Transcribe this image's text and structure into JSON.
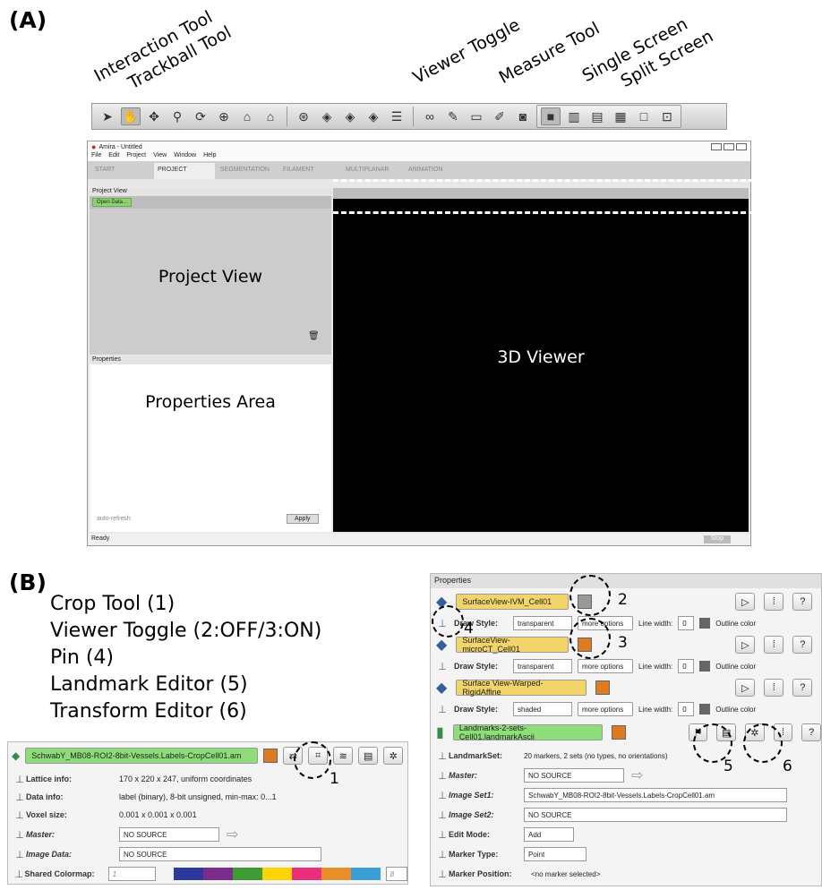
{
  "labels": {
    "a": "(A)",
    "b": "(B)"
  },
  "callouts": [
    "Interaction Tool",
    "Trackball Tool",
    "Viewer Toggle",
    "Measure Tool",
    "Single Screen",
    "Split Screen"
  ],
  "toolbar_icons": [
    "arrow-icon",
    "hand-icon",
    "pan-icon",
    "zoom-icon",
    "rotate-icon",
    "seek-icon",
    "home-icon",
    "set-home-icon",
    "viewer-icon",
    "xy-icon",
    "xz-icon",
    "yz-icon",
    "layers-icon",
    "stereo-icon",
    "measure-icon",
    "ruler-icon",
    "pen-icon",
    "camera-icon",
    "single-screen-icon",
    "split-vertical-icon",
    "split-horizontal-icon",
    "quad-icon",
    "empty-icon",
    "split-screen-icon"
  ],
  "window": {
    "title": "Amira - Untitled",
    "menu": [
      "File",
      "Edit",
      "Project",
      "View",
      "Window",
      "Help"
    ],
    "tabs": [
      "START",
      "PROJECT",
      "SEGMENTATION",
      "FILAMENT",
      "MULTIPLANAR",
      "ANIMATION"
    ],
    "project_view_header": "Project View",
    "open_data": "Open Data...",
    "project_view_label": "Project View",
    "properties_header": "Properties",
    "properties_label": "Properties Area",
    "auto_refresh": "auto-refresh",
    "apply": "Apply",
    "viewer_label": "3D Viewer",
    "status": "Ready",
    "stop": "Stop"
  },
  "legend": [
    "Crop Tool (1)",
    "Viewer Toggle (2:OFF/3:ON)",
    "Pin (4)",
    "Landmark Editor (5)",
    "Transform Editor (6)"
  ],
  "left_panel": {
    "module": "SchwabY_MB08-ROI2-8bit-Vessels.Labels-CropCell01.am",
    "rows": [
      {
        "label": "Lattice info:",
        "value": "170 x 220 x 247, uniform coordinates"
      },
      {
        "label": "Data info:",
        "value": "label (binary), 8-bit unsigned, min-max: 0...1"
      },
      {
        "label": "Voxel size:",
        "value": "0.001 x 0.001 x 0.001"
      },
      {
        "label": "Master:",
        "value": "NO SOURCE"
      },
      {
        "label": "Image Data:",
        "value": "NO SOURCE"
      },
      {
        "label": "Shared Colormap:",
        "value": "1",
        "value2": "8"
      }
    ],
    "marker": "1",
    "colormap": [
      "#2b3a9c",
      "#7b2d8e",
      "#3f9c35",
      "#ffd400",
      "#e8307c",
      "#e8902a",
      "#3aa0d8"
    ]
  },
  "right_panel": {
    "header": "Properties",
    "modules": [
      {
        "name": "SurfaceView-IVM_Cell01",
        "draw_style": "transparent",
        "more": "more options",
        "line_width": "0",
        "outline": "Outline color",
        "toggle": "#999999"
      },
      {
        "name": "SurfaceView-microCT_Cell01",
        "draw_style": "transparent",
        "more": "more options",
        "line_width": "0",
        "outline": "Outline color",
        "toggle": "#e07a20"
      },
      {
        "name": "Surface View-Warped-RigidAffine",
        "draw_style": "shaded",
        "more": "more options",
        "line_width": "0",
        "outline": "Outline color",
        "toggle": "#e07a20"
      }
    ],
    "draw_style_label": "Draw Style:",
    "line_width_label": "Line width:",
    "landmarks": {
      "name": "Landmarks-2-sets-Cell01.landmarkAscii",
      "rows": [
        {
          "label": "LandmarkSet:",
          "value": "20 markers, 2 sets (no types, no orientations)"
        },
        {
          "label": "Master:",
          "value": "NO SOURCE"
        },
        {
          "label": "Image Set1:",
          "value": "SchwabY_MB08-ROI2-8bit-Vessels.Labels-CropCell01.am"
        },
        {
          "label": "Image Set2:",
          "value": "NO SOURCE"
        },
        {
          "label": "Edit Mode:",
          "value": "Add"
        },
        {
          "label": "Marker Type:",
          "value": "Point"
        },
        {
          "label": "Marker Position:",
          "value": "<no marker selected>"
        }
      ]
    },
    "markers": [
      "2",
      "3",
      "4",
      "5",
      "6"
    ]
  }
}
